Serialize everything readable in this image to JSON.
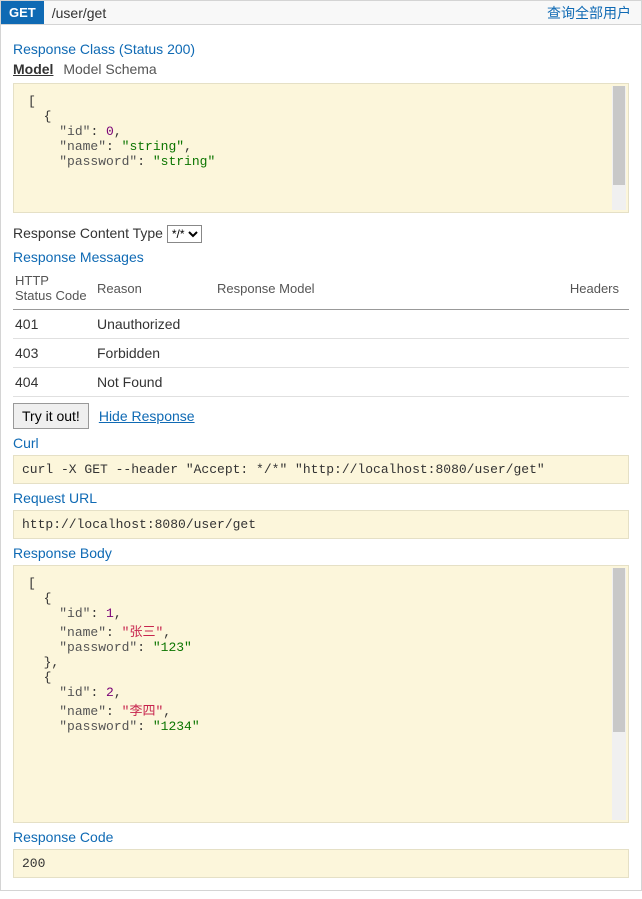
{
  "header": {
    "method": "GET",
    "path": "/user/get",
    "description": "查询全部用户"
  },
  "response_class": {
    "title": "Response Class (Status 200)",
    "model_label": "Model",
    "schema_label": "Model Schema",
    "schema_text": "[\n  {\n    \"id\": 0,\n    \"name\": \"string\",\n    \"password\": \"string\""
  },
  "content_type": {
    "label": "Response Content Type",
    "selected": "*/*"
  },
  "messages": {
    "title": "Response Messages",
    "columns": [
      "HTTP Status Code",
      "Reason",
      "Response Model",
      "Headers"
    ],
    "rows": [
      {
        "code": "401",
        "reason": "Unauthorized"
      },
      {
        "code": "403",
        "reason": "Forbidden"
      },
      {
        "code": "404",
        "reason": "Not Found"
      }
    ]
  },
  "actions": {
    "try_label": "Try it out!",
    "hide_label": "Hide Response"
  },
  "curl": {
    "title": "Curl",
    "command": "curl -X GET --header \"Accept: */*\" \"http://localhost:8080/user/get\""
  },
  "request_url": {
    "title": "Request URL",
    "value": "http://localhost:8080/user/get"
  },
  "response_body": {
    "title": "Response Body",
    "data": [
      {
        "id": 1,
        "name": "张三",
        "password": "123"
      },
      {
        "id": 2,
        "name": "李四",
        "password": "1234"
      }
    ]
  },
  "response_code": {
    "title": "Response Code",
    "value": "200"
  }
}
